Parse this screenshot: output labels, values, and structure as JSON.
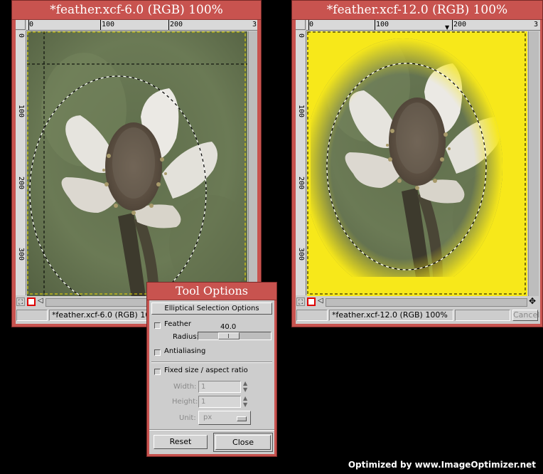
{
  "left_window": {
    "title": "*feather.xcf-6.0 (RGB) 100%",
    "ruler_h": [
      "0",
      "100",
      "200",
      "3"
    ],
    "ruler_v": [
      "0",
      "100",
      "200",
      "300"
    ],
    "status": "*feather.xcf-6.0 (RGB) 100%"
  },
  "right_window": {
    "title": "*feather.xcf-12.0 (RGB) 100%",
    "ruler_h": [
      "0",
      "100",
      "200",
      "3"
    ],
    "ruler_v": [
      "0",
      "100",
      "200",
      "300"
    ],
    "status": "*feather.xcf-12.0 (RGB) 100%",
    "cancel_label": "Cancel",
    "background_color": "#f7e81a"
  },
  "tool_options": {
    "title": "Tool Options",
    "header": "Elliptical Selection Options",
    "feather_label": "Feather",
    "radius_label": "Radius:",
    "radius_value": "40.0",
    "antialiasing_label": "Antialiasing",
    "fixed_size_label": "Fixed size / aspect ratio",
    "width_label": "Width:",
    "width_value": "1",
    "height_label": "Height:",
    "height_value": "1",
    "unit_label": "Unit:",
    "unit_value": "px",
    "reset_label": "Reset",
    "close_label": "Close"
  },
  "footer": "Optimized by www.ImageOptimizer.net"
}
